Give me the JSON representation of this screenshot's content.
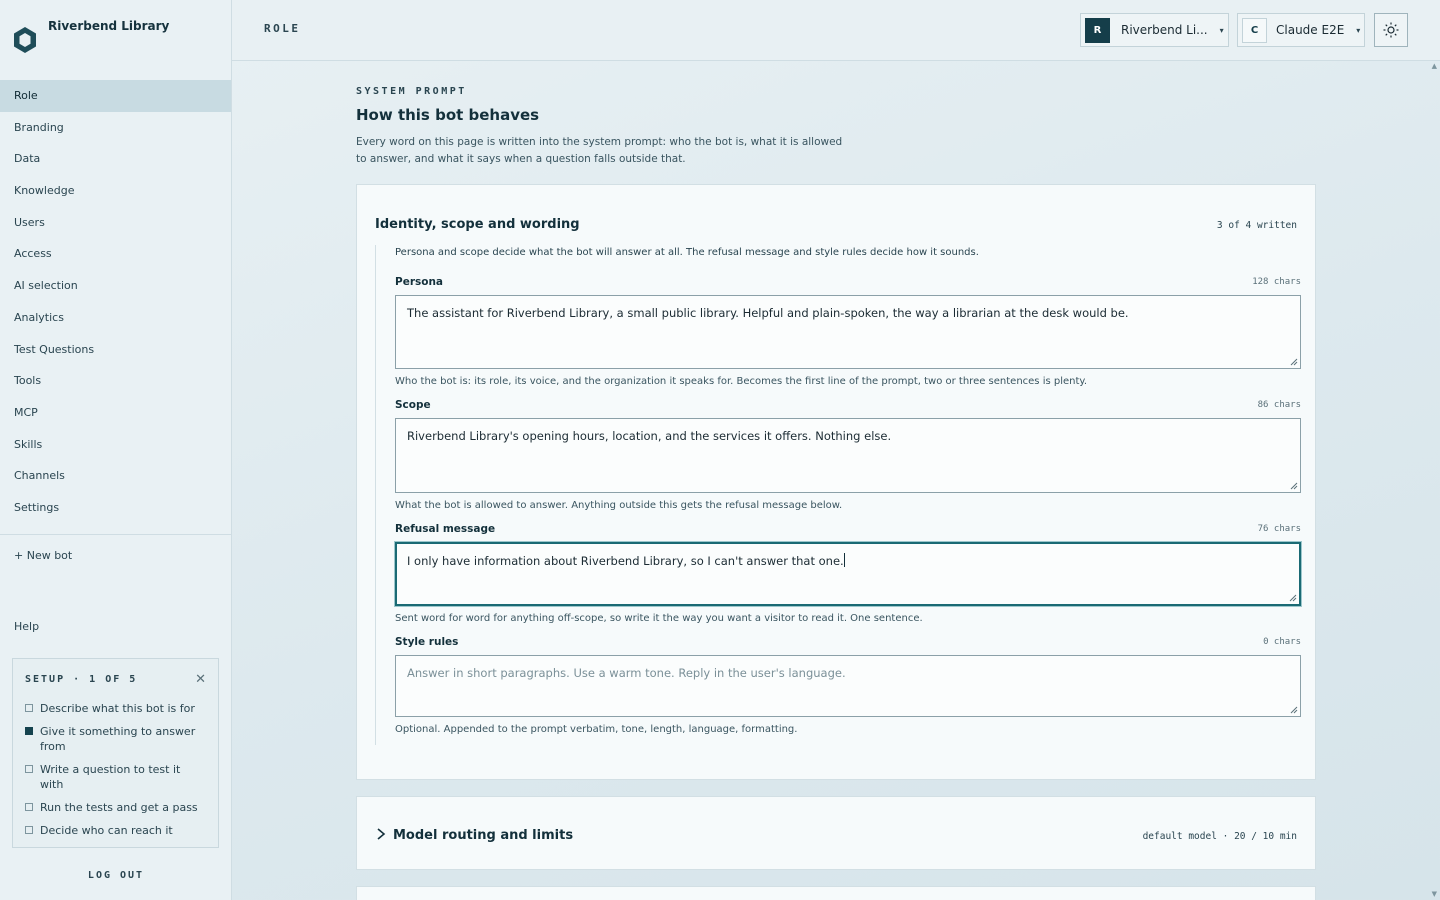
{
  "brand": {
    "name": "Riverbend Library",
    "logo_icon": "hexagon-logo-icon"
  },
  "sidebar": {
    "items": [
      {
        "label": "Role",
        "active": true
      },
      {
        "label": "Branding"
      },
      {
        "label": "Data"
      },
      {
        "label": "Knowledge"
      },
      {
        "label": "Users"
      },
      {
        "label": "Access"
      },
      {
        "label": "AI selection"
      },
      {
        "label": "Analytics"
      },
      {
        "label": "Test Questions"
      },
      {
        "label": "Tools"
      },
      {
        "label": "MCP"
      },
      {
        "label": "Skills"
      },
      {
        "label": "Channels"
      },
      {
        "label": "Settings"
      }
    ],
    "new_bot": "+ New bot",
    "help": "Help",
    "logout": "LOG OUT"
  },
  "setup": {
    "title": "SETUP · 1 OF 5",
    "close_icon": "close-icon",
    "items": [
      {
        "label": "Describe what this bot is for",
        "done": false
      },
      {
        "label": "Give it something to answer from",
        "done": true
      },
      {
        "label": "Write a question to test it with",
        "done": false
      },
      {
        "label": "Run the tests and get a pass",
        "done": false
      },
      {
        "label": "Decide who can reach it",
        "done": false
      }
    ]
  },
  "topbar": {
    "title": "ROLE",
    "org": {
      "badge": "R",
      "name": "Riverbend Li..."
    },
    "user": {
      "badge": "C",
      "name": "Claude E2E"
    },
    "theme_icon": "sun-icon"
  },
  "page": {
    "eyebrow": "SYSTEM PROMPT",
    "heading": "How this bot behaves",
    "description": "Every word on this page is written into the system prompt: who the bot is, what it is allowed to answer, and what it says when a question falls outside that."
  },
  "identity_card": {
    "title": "Identity, scope and wording",
    "count": "3 of 4 written",
    "intro": "Persona and scope decide what the bot will answer at all. The refusal message and style rules decide how it sounds.",
    "fields": {
      "persona": {
        "label": "Persona",
        "count": "128 chars",
        "value": "The assistant for Riverbend Library, a small public library. Helpful and plain-spoken, the way a librarian at the desk would be.",
        "help": "Who the bot is: its role, its voice, and the organization it speaks for. Becomes the first line of the prompt, two or three sentences is plenty."
      },
      "scope": {
        "label": "Scope",
        "count": "86 chars",
        "value": "Riverbend Library's opening hours, location, and the services it offers. Nothing else.",
        "help": "What the bot is allowed to answer. Anything outside this gets the refusal message below."
      },
      "refusal": {
        "label": "Refusal message",
        "count": "76 chars",
        "value": "I only have information about Riverbend Library, so I can't answer that one.",
        "help": "Sent word for word for anything off-scope, so write it the way you want a visitor to read it. One sentence."
      },
      "style": {
        "label": "Style rules",
        "count": "0 chars",
        "value": "",
        "placeholder": "Answer in short paragraphs. Use a warm tone. Reply in the user's language.",
        "help": "Optional. Appended to the prompt verbatim, tone, length, language, formatting."
      }
    }
  },
  "routing_card": {
    "title": "Model routing and limits",
    "meta": "default model · 20 / 10 min",
    "chevron_icon": "chevron-right-icon"
  }
}
